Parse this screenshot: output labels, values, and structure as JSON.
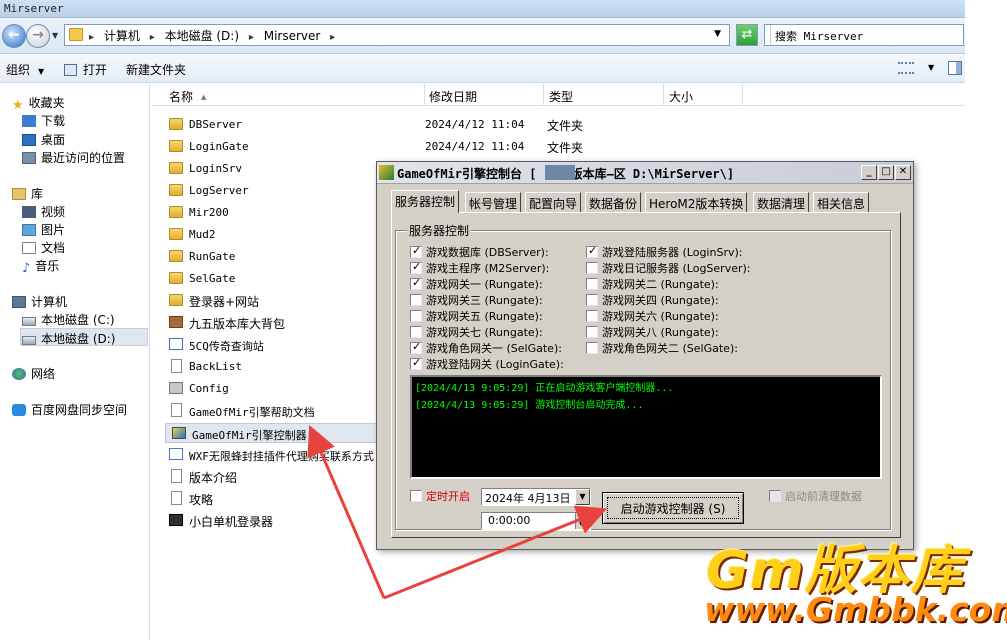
{
  "window": {
    "title": "Mirserver"
  },
  "address": {
    "crumbs": [
      "计算机",
      "本地磁盘 (D:)",
      "Mirserver"
    ],
    "search_placeholder": "搜索 Mirserver"
  },
  "toolbar": {
    "organize": "组织",
    "open": "打开",
    "new_folder": "新建文件夹"
  },
  "nav": {
    "favorites": "收藏夹",
    "downloads": "下载",
    "desktop": "桌面",
    "recent": "最近访问的位置",
    "libraries": "库",
    "videos": "视频",
    "pictures": "图片",
    "documents": "文档",
    "music": "音乐",
    "computer": "计算机",
    "drive_c": "本地磁盘 (C:)",
    "drive_d": "本地磁盘 (D:)",
    "network": "网络",
    "baidu": "百度网盘同步空间"
  },
  "columns": {
    "name": "名称",
    "date": "修改日期",
    "type": "类型",
    "size": "大小"
  },
  "files": [
    {
      "name": "DBServer",
      "date": "2024/4/12 11:04",
      "type": "文件夹",
      "icon": "folder"
    },
    {
      "name": "LoginGate",
      "date": "2024/4/12 11:04",
      "type": "文件夹",
      "icon": "folder"
    },
    {
      "name": "LoginSrv",
      "date": "",
      "type": "",
      "icon": "folder"
    },
    {
      "name": "LogServer",
      "date": "",
      "type": "",
      "icon": "folder"
    },
    {
      "name": "Mir200",
      "date": "",
      "type": "",
      "icon": "folder"
    },
    {
      "name": "Mud2",
      "date": "",
      "type": "",
      "icon": "folder"
    },
    {
      "name": "RunGate",
      "date": "",
      "type": "",
      "icon": "folder"
    },
    {
      "name": "SelGate",
      "date": "",
      "type": "",
      "icon": "folder"
    },
    {
      "name": "登录器+网站",
      "date": "",
      "type": "",
      "icon": "folder"
    },
    {
      "name": "九五版本库大背包",
      "date": "",
      "type": "",
      "icon": "box"
    },
    {
      "name": "5CQ传奇查询站",
      "date": "",
      "type": "",
      "icon": "web"
    },
    {
      "name": "BackList",
      "date": "",
      "type": "",
      "icon": "file"
    },
    {
      "name": "Config",
      "date": "",
      "type": "",
      "icon": "app"
    },
    {
      "name": "GameOfMir引擎帮助文档",
      "date": "",
      "type": "",
      "icon": "file"
    },
    {
      "name": "GameOfMir引擎控制器",
      "date": "",
      "type": "",
      "icon": "mir"
    },
    {
      "name": "WXF无限蜂封挂插件代理购买联系方式",
      "date": "",
      "type": "",
      "icon": "web"
    },
    {
      "name": "版本介绍",
      "date": "",
      "type": "",
      "icon": "file"
    },
    {
      "name": "攻略",
      "date": "",
      "type": "",
      "icon": "file"
    },
    {
      "name": "小白单机登录器",
      "date": "",
      "type": "",
      "icon": "exe"
    }
  ],
  "dialog": {
    "title": "GameOfMir引擎控制台 [",
    "title_rest": "版本库—区 D:\\MirServer\\]",
    "tabs": [
      "服务器控制",
      "帐号管理",
      "配置向导",
      "数据备份",
      "HeroM2版本转换",
      "数据清理",
      "相关信息"
    ],
    "group_label": "服务器控制",
    "checks": [
      {
        "label": "游戏数据库 (DBServer):",
        "checked": true
      },
      {
        "label": "游戏登陆服务器 (LoginSrv):",
        "checked": true
      },
      {
        "label": "游戏主程序 (M2Server):",
        "checked": true
      },
      {
        "label": "游戏日记服务器 (LogServer):",
        "checked": false
      },
      {
        "label": "游戏网关一 (Rungate):",
        "checked": true
      },
      {
        "label": "游戏网关二 (Rungate):",
        "checked": false
      },
      {
        "label": "游戏网关三 (Rungate):",
        "checked": false
      },
      {
        "label": "游戏网关四 (Rungate):",
        "checked": false
      },
      {
        "label": "游戏网关五 (Rungate):",
        "checked": false
      },
      {
        "label": "游戏网关六 (Rungate):",
        "checked": false
      },
      {
        "label": "游戏网关七 (Rungate):",
        "checked": false
      },
      {
        "label": "游戏网关八 (Rungate):",
        "checked": false
      },
      {
        "label": "游戏角色网关一 (SelGate):",
        "checked": true
      },
      {
        "label": "游戏角色网关二 (SelGate):",
        "checked": false
      },
      {
        "label": "游戏登陆网关 (LoginGate):",
        "checked": true
      }
    ],
    "log": [
      "[2024/4/13 9:05:29] 正在启动游戏客户端控制器...",
      "[2024/4/13 9:05:29] 游戏控制台启动完成..."
    ],
    "timer_label": "定时开启",
    "timer_checked": false,
    "date_value": "2024年 4月13日",
    "time_value": "0:00:00",
    "start_button": "启动游戏控制器 (S)",
    "clean_label": "启动前清理数据",
    "colors": {
      "log_text": "#00ff00",
      "timer_label": "#d00000"
    }
  },
  "watermark": {
    "line1": "Gm版本库",
    "line2": "www.Gmbbk.com"
  }
}
